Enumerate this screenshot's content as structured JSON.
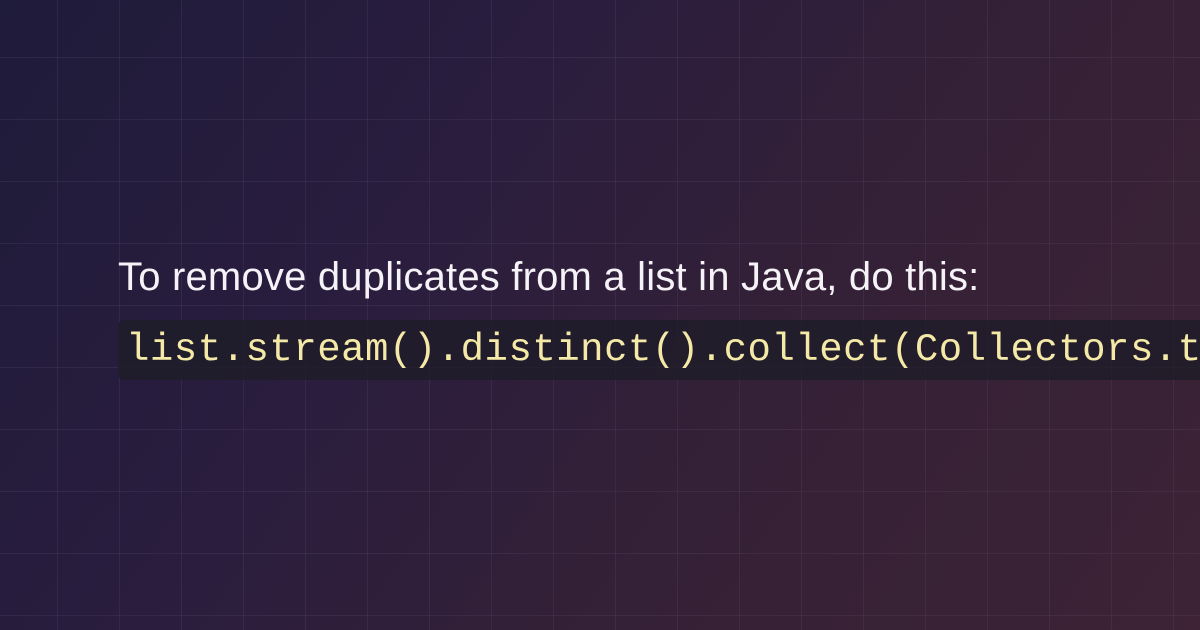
{
  "heading": "To remove duplicates from a list in Java, do this:",
  "code": "list.stream().distinct().collect(Collectors.toList())"
}
